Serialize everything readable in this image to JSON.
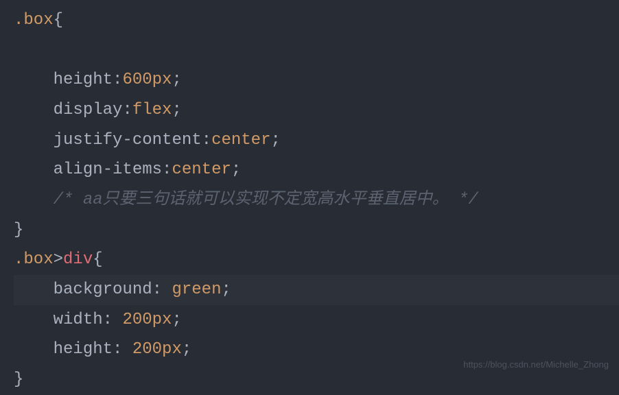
{
  "code": {
    "line1_selector": ".box",
    "line1_brace": "{",
    "line2": "",
    "line3_prop": "height",
    "line3_val": "600px",
    "line4_prop": "display",
    "line4_val": "flex",
    "line5_prop": "justify-content",
    "line5_val": "center",
    "line6_prop": "align-items",
    "line6_val": "center",
    "line7_comment": "/* aa只要三句话就可以实现不定宽高水平垂直居中。 */",
    "line8_brace": "}",
    "line9_sel1": ".box",
    "line9_gt": ">",
    "line9_sel2": "div",
    "line9_brace": "{",
    "line10_prop": "background",
    "line10_val": "green",
    "line11_prop": "width",
    "line11_val": "200px",
    "line12_prop": "height",
    "line12_val": "200px",
    "line13_brace": "}"
  },
  "watermark": "https://blog.csdn.net/Michelle_Zhong"
}
